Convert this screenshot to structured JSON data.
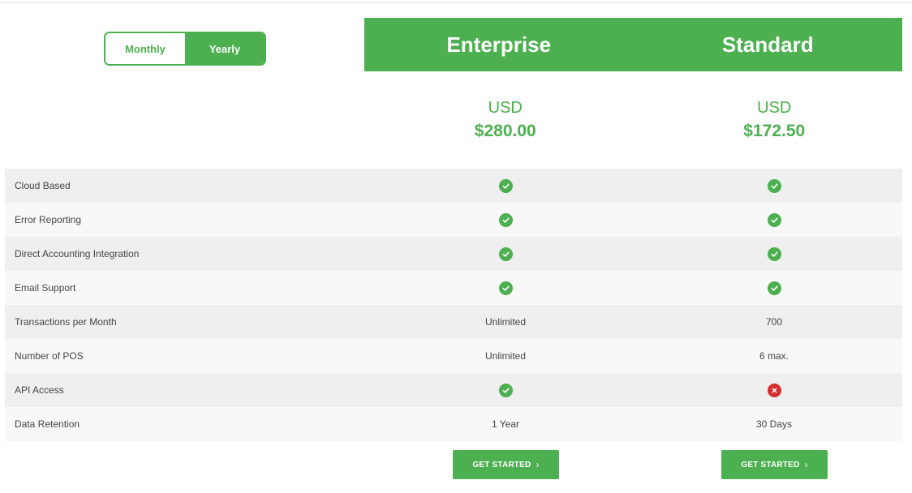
{
  "billing_toggle": {
    "monthly_label": "Monthly",
    "yearly_label": "Yearly",
    "selected": "Yearly"
  },
  "plans": [
    {
      "name": "Enterprise",
      "currency": "USD",
      "price": "$280.00",
      "cta": "GET STARTED"
    },
    {
      "name": "Standard",
      "currency": "USD",
      "price": "$172.50",
      "cta": "GET STARTED"
    }
  ],
  "features": [
    {
      "label": "Cloud Based",
      "enterprise": "check",
      "standard": "check"
    },
    {
      "label": "Error Reporting",
      "enterprise": "check",
      "standard": "check"
    },
    {
      "label": "Direct Accounting Integration",
      "enterprise": "check",
      "standard": "check"
    },
    {
      "label": "Email Support",
      "enterprise": "check",
      "standard": "check"
    },
    {
      "label": "Transactions per Month",
      "enterprise": "Unlimited",
      "standard": "700"
    },
    {
      "label": "Number of POS",
      "enterprise": "Unlimited",
      "standard": "6 max."
    },
    {
      "label": "API Access",
      "enterprise": "check",
      "standard": "cross"
    },
    {
      "label": "Data Retention",
      "enterprise": "1 Year",
      "standard": "30 Days"
    }
  ],
  "icons": {
    "check": "check-circle-icon",
    "cross": "x-circle-icon",
    "button_arrow": "chevron-right-icon"
  },
  "colors": {
    "accent": "#4caf50",
    "negative": "#d32f2f"
  }
}
